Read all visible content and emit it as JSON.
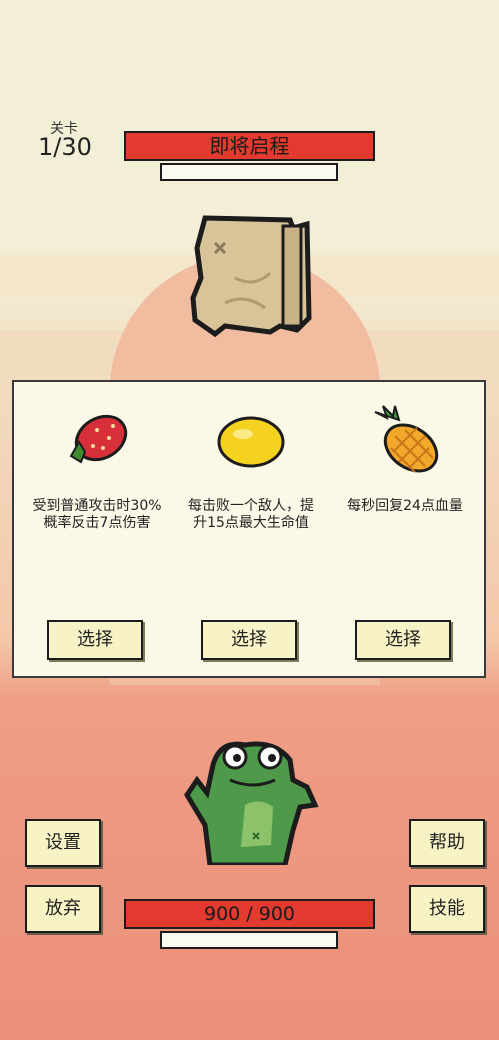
{
  "level": {
    "label": "关卡",
    "value": "1/30"
  },
  "stage_bar": {
    "label": "即将启程"
  },
  "cards": [
    {
      "icon": "strawberry-icon",
      "desc": "受到普通攻击时30%概率反击7点伤害",
      "button": "选择"
    },
    {
      "icon": "lemon-icon",
      "desc": "每击败一个敌人，提升15点最大生命值",
      "button": "选择"
    },
    {
      "icon": "pineapple-icon",
      "desc": "每秒回复24点血量",
      "button": "选择"
    }
  ],
  "buttons": {
    "settings": "设置",
    "help": "帮助",
    "give_up": "放弃",
    "skills": "技能"
  },
  "hp": {
    "text": "900 / 900",
    "current": 900,
    "max": 900
  },
  "colors": {
    "hp_red": "#e23a2e",
    "button_fill": "#f8f3c4",
    "panel_fill": "#fbf8e7"
  }
}
